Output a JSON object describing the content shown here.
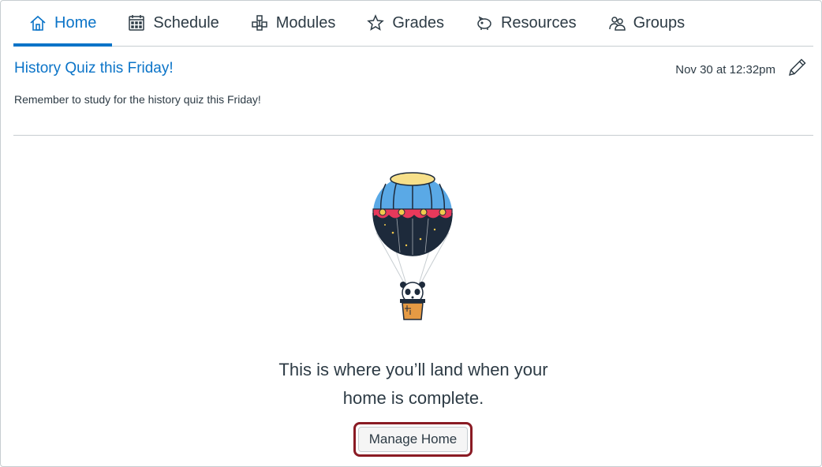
{
  "tabs": [
    {
      "label": "Home",
      "icon": "home-icon",
      "active": true
    },
    {
      "label": "Schedule",
      "icon": "calendar-icon",
      "active": false
    },
    {
      "label": "Modules",
      "icon": "modules-icon",
      "active": false
    },
    {
      "label": "Grades",
      "icon": "star-icon",
      "active": false
    },
    {
      "label": "Resources",
      "icon": "piggy-bank-icon",
      "active": false
    },
    {
      "label": "Groups",
      "icon": "groups-icon",
      "active": false
    }
  ],
  "announcement": {
    "title": "History Quiz this Friday!",
    "date": "Nov 30 at 12:32pm",
    "body": "Remember to study for the history quiz this Friday!",
    "edit_icon": "pencil-icon"
  },
  "empty_state": {
    "message_line1": "This is where you’ll land when your",
    "message_line2": "home is complete.",
    "illustration": "hot-air-balloon-panda-illustration",
    "button_label": "Manage Home"
  },
  "colors": {
    "accent": "#0b74c8",
    "text": "#2d3b45",
    "highlight_border": "#8a1b24"
  }
}
